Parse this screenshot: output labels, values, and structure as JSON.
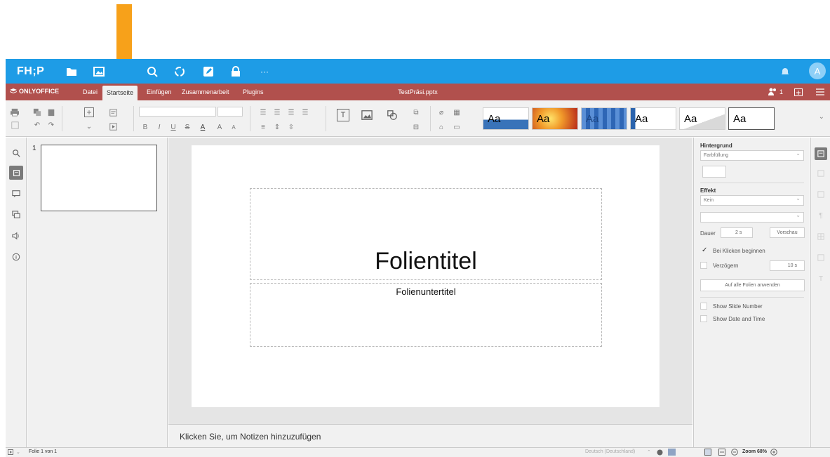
{
  "app": {
    "brand": "FH;P",
    "avatar_initial": "A",
    "accent": "#1e9ce6",
    "menubar_color": "#b1504d"
  },
  "menubar": {
    "logo": "ONLYOFFICE",
    "tabs": [
      {
        "label": "Datei"
      },
      {
        "label": "Startseite"
      },
      {
        "label": "Einfügen"
      },
      {
        "label": "Zusammenarbeit"
      },
      {
        "label": "Plugins"
      }
    ],
    "active_tab": "Startseite",
    "doc_title": "TestPräsi.pptx",
    "users_count": "1"
  },
  "toolbar": {
    "themes": [
      {
        "label": "Aa",
        "style": "blue"
      },
      {
        "label": "Aa",
        "style": "orange"
      },
      {
        "label": "Aa",
        "style": "blue-grid"
      },
      {
        "label": "Aa",
        "style": "blue-line"
      },
      {
        "label": "Aa",
        "style": "grey"
      },
      {
        "label": "Aa",
        "style": "plain"
      }
    ]
  },
  "thumbnails": [
    {
      "number": "1"
    }
  ],
  "slide": {
    "title": "Folientitel",
    "subtitle": "Folienuntertitel"
  },
  "notes": {
    "placeholder": "Klicken Sie, um Notizen hinzuzufügen"
  },
  "right_panel": {
    "background_label": "Hintergrund",
    "background_value": "Farbfüllung",
    "effect_label": "Effekt",
    "effect_value": "Kein",
    "duration_label": "Dauer",
    "duration_value": "2 s",
    "preview_button": "Vorschau",
    "start_on_click": "Bei Klicken beginnen",
    "start_on_click_checked": true,
    "delay_label": "Verzögern",
    "delay_value": "10 s",
    "apply_all_button": "Auf alle Folien anwenden",
    "show_slide_number": "Show Slide Number",
    "show_date_time": "Show Date and Time"
  },
  "status": {
    "slide_info": "Folie 1 von 1",
    "language": "Deutsch (Deutschland)",
    "zoom": "Zoom 68%"
  }
}
